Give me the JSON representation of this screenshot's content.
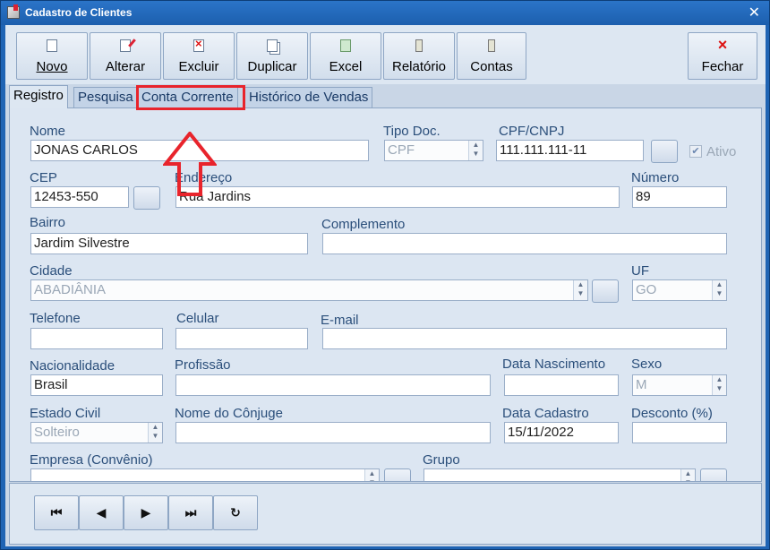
{
  "window": {
    "title": "Cadastro de Clientes",
    "close_symbol": "✕"
  },
  "toolbar": {
    "buttons": [
      {
        "label": "Novo",
        "icon": "new-document-icon"
      },
      {
        "label": "Alterar",
        "icon": "edit-document-icon"
      },
      {
        "label": "Excluir",
        "icon": "delete-document-icon"
      },
      {
        "label": "Duplicar",
        "icon": "duplicate-document-icon"
      },
      {
        "label": "Excel",
        "icon": "excel-icon"
      },
      {
        "label": "Relatório",
        "icon": "report-icon"
      },
      {
        "label": "Contas",
        "icon": "accounts-icon"
      },
      {
        "label": "Fechar",
        "icon": "close-x-icon"
      }
    ]
  },
  "tabs": [
    "Registro",
    "Pesquisa",
    "Conta Corrente",
    "Histórico de Vendas"
  ],
  "active_tab": "Registro",
  "highlighted_tab": "Conta Corrente",
  "form": {
    "nome": {
      "label": "Nome",
      "value": "JONAS CARLOS"
    },
    "tipo_doc": {
      "label": "Tipo Doc.",
      "value": "CPF"
    },
    "cpf_cnpj": {
      "label": "CPF/CNPJ",
      "value": "111.111.111-11"
    },
    "ativo": {
      "label": "Ativo",
      "checked": true
    },
    "cep": {
      "label": "CEP",
      "value": "12453-550"
    },
    "endereco": {
      "label": "Endereço",
      "value": "Rua Jardins"
    },
    "numero": {
      "label": "Número",
      "value": "89"
    },
    "bairro": {
      "label": "Bairro",
      "value": "Jardim Silvestre"
    },
    "complemento": {
      "label": "Complemento",
      "value": ""
    },
    "cidade": {
      "label": "Cidade",
      "value": "ABADIÂNIA"
    },
    "uf": {
      "label": "UF",
      "value": "GO"
    },
    "telefone": {
      "label": "Telefone",
      "value": ""
    },
    "celular": {
      "label": "Celular",
      "value": ""
    },
    "email": {
      "label": "E-mail",
      "value": ""
    },
    "nacionalidade": {
      "label": "Nacionalidade",
      "value": "Brasil"
    },
    "profissao": {
      "label": "Profissão",
      "value": ""
    },
    "data_nascimento": {
      "label": "Data Nascimento",
      "value": ""
    },
    "sexo": {
      "label": "Sexo",
      "value": "M"
    },
    "estado_civil": {
      "label": "Estado Civil",
      "value": "Solteiro"
    },
    "nome_conjuge": {
      "label": "Nome do Cônjuge",
      "value": ""
    },
    "data_cadastro": {
      "label": "Data Cadastro",
      "value": "15/11/2022"
    },
    "desconto": {
      "label": "Desconto (%)",
      "value": ""
    },
    "empresa": {
      "label": "Empresa (Convênio)",
      "value": ""
    },
    "grupo": {
      "label": "Grupo",
      "value": ""
    }
  },
  "navigation": {
    "first": "⏮",
    "prev": "◀",
    "next": "▶",
    "last": "⏭",
    "refresh": "↻"
  },
  "colors": {
    "highlight": "#e8242c",
    "accent": "#1f64b4"
  }
}
